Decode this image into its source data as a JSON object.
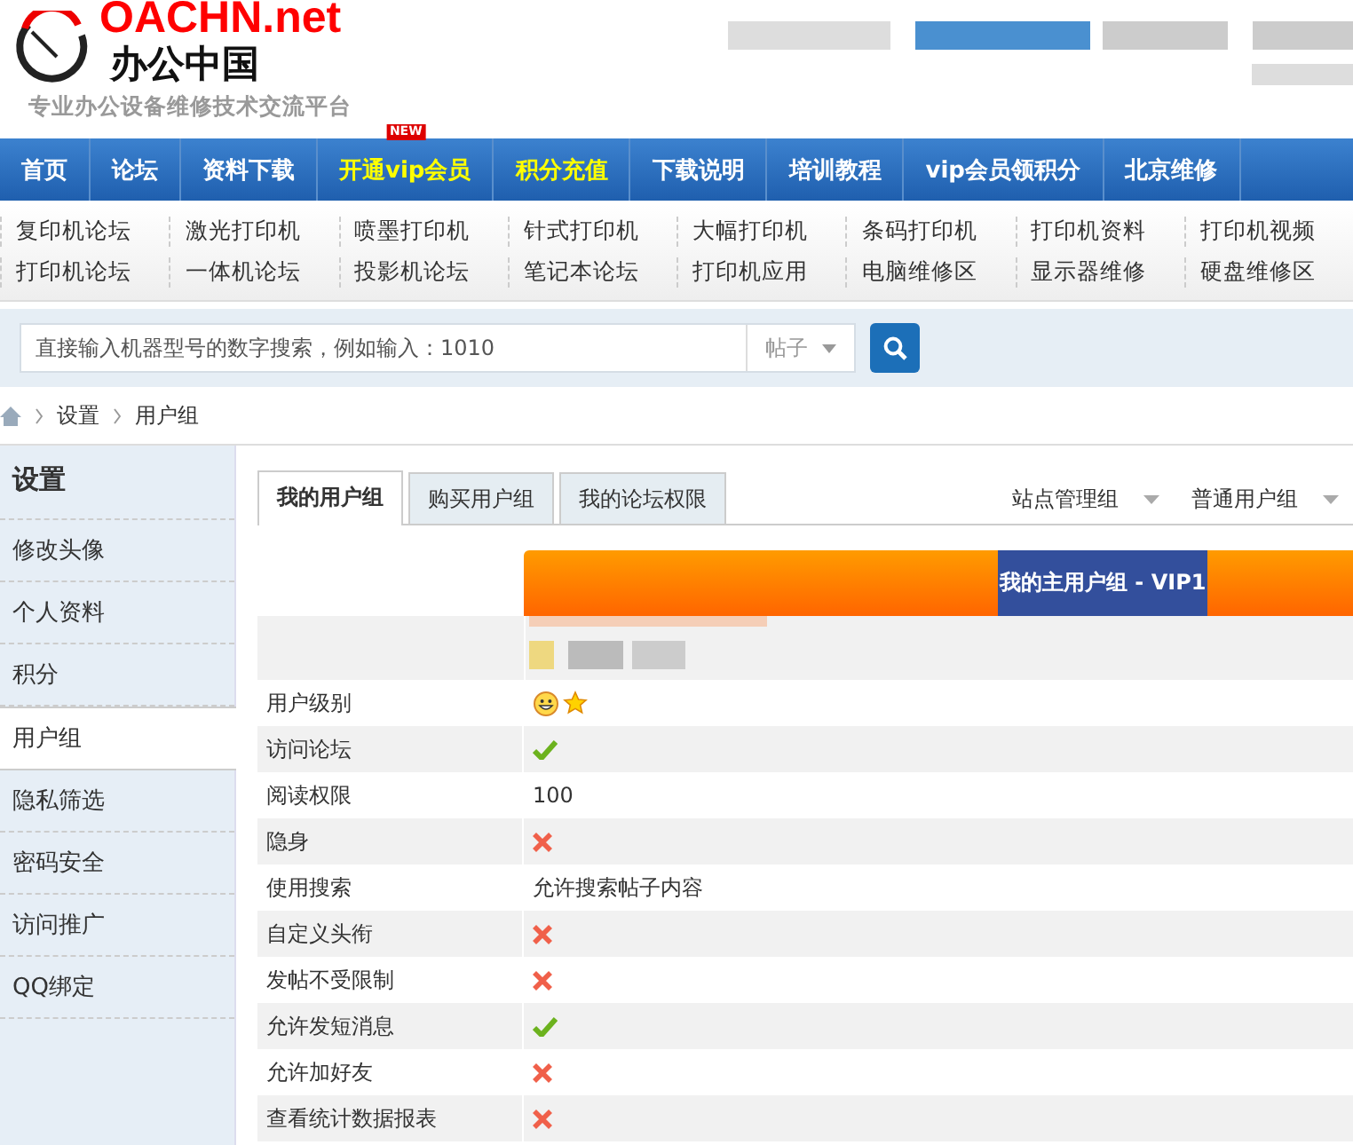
{
  "header": {
    "logo_text": "OACHN.net",
    "site_name": "办公中国",
    "tagline": "专业办公设备维修技术交流平台"
  },
  "nav": [
    {
      "label": "首页",
      "highlight": false
    },
    {
      "label": "论坛",
      "highlight": false
    },
    {
      "label": "资料下载",
      "highlight": false
    },
    {
      "label": "开通vip会员",
      "highlight": true,
      "badge": "NEW"
    },
    {
      "label": "积分充值",
      "highlight": true
    },
    {
      "label": "下载说明",
      "highlight": false
    },
    {
      "label": "培训教程",
      "highlight": false
    },
    {
      "label": "vip会员领积分",
      "highlight": false
    },
    {
      "label": "北京维修",
      "highlight": false
    }
  ],
  "forums": [
    "复印机论坛",
    "激光打印机",
    "喷墨打印机",
    "针式打印机",
    "大幅打印机",
    "条码打印机",
    "打印机资料",
    "打印机视频",
    "打印机论坛",
    "一体机论坛",
    "投影机论坛",
    "笔记本论坛",
    "打印机应用",
    "电脑维修区",
    "显示器维修",
    "硬盘维修区"
  ],
  "search": {
    "placeholder": "直接输入机器型号的数字搜索，例如输入：1010",
    "scope": "帖子"
  },
  "breadcrumb": [
    "设置",
    "用户组"
  ],
  "sidebar": {
    "title": "设置",
    "items": [
      {
        "label": "修改头像",
        "selected": false
      },
      {
        "label": "个人资料",
        "selected": false
      },
      {
        "label": "积分",
        "selected": false
      },
      {
        "label": "用户组",
        "selected": true
      },
      {
        "label": "隐私筛选",
        "selected": false
      },
      {
        "label": "密码安全",
        "selected": false
      },
      {
        "label": "访问推广",
        "selected": false
      },
      {
        "label": "QQ绑定",
        "selected": false
      }
    ]
  },
  "tabs": [
    {
      "label": "我的用户组",
      "selected": true
    },
    {
      "label": "购买用户组",
      "selected": false
    },
    {
      "label": "我的论坛权限",
      "selected": false
    }
  ],
  "dropdowns": [
    "站点管理组",
    "普通用户组"
  ],
  "group_header": "我的主用户组 - VIP1",
  "rows": [
    {
      "label": "用户级别",
      "kind": "level_icons"
    },
    {
      "label": "访问论坛",
      "kind": "yes"
    },
    {
      "label": "阅读权限",
      "kind": "text",
      "value": "100"
    },
    {
      "label": "隐身",
      "kind": "no"
    },
    {
      "label": "使用搜索",
      "kind": "text",
      "value": "允许搜索帖子内容"
    },
    {
      "label": "自定义头衔",
      "kind": "no"
    },
    {
      "label": "发帖不受限制",
      "kind": "no"
    },
    {
      "label": "允许发短消息",
      "kind": "yes"
    },
    {
      "label": "允许加好友",
      "kind": "no"
    },
    {
      "label": "查看统计数据报表",
      "kind": "no"
    }
  ]
}
